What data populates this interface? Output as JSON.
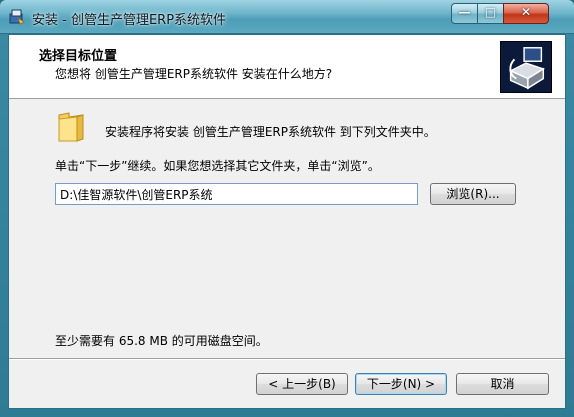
{
  "window": {
    "title": "安装 - 创管生产管理ERP系统软件",
    "app_icon": "installer-icon",
    "controls": {
      "minimize_glyph": "—",
      "maximize_glyph": "□",
      "close_glyph": "✕"
    }
  },
  "header": {
    "title": "选择目标位置",
    "subtitle": "您想将 创管生产管理ERP系统软件 安装在什么地方?",
    "logo_icon": "computer-box-logo-icon"
  },
  "body": {
    "folder_icon": "folder-icon",
    "intro": "安装程序将安装 创管生产管理ERP系统软件 到下列文件夹中。",
    "continue_hint": "单击“下一步”继续。如果您想选择其它文件夹，单击“浏览”。",
    "path_value": "D:\\佳智源软件\\创管ERP系统",
    "browse_label": "浏览(R)...",
    "space_required": "至少需要有 65.8 MB 的可用磁盘空间。"
  },
  "footer": {
    "back_label": "< 上一步(B)",
    "next_label": "下一步(N) >",
    "cancel_label": "取消"
  },
  "colors": {
    "titlebar": "#6db5cb",
    "close_button": "#c0361b",
    "client_bg": "#f0f0f0",
    "logo_bg": "#0b1a3a"
  }
}
